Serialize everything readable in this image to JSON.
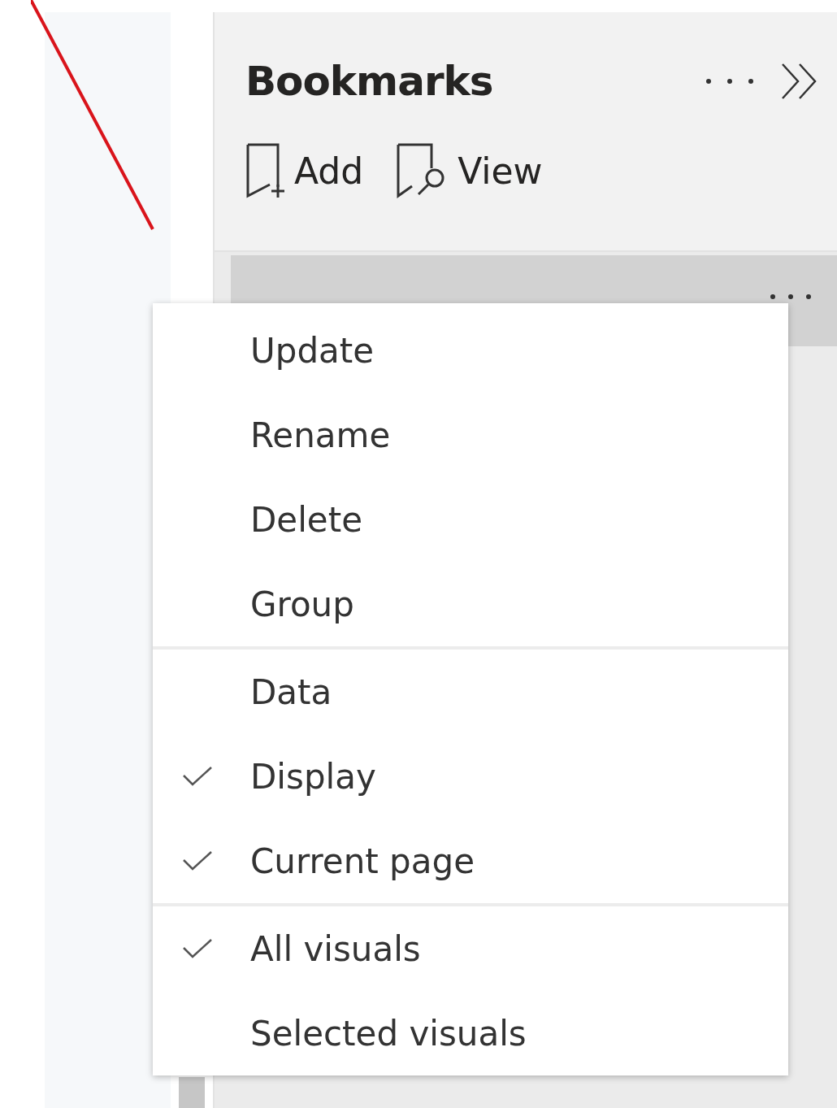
{
  "pane": {
    "title": "Bookmarks"
  },
  "toolbar": [
    {
      "kind": "add",
      "label": "Add"
    },
    {
      "kind": "view",
      "label": "View"
    }
  ],
  "bookmarks": [
    {
      "selected": true
    }
  ],
  "context_menu": {
    "sections": [
      [
        {
          "label": "Update"
        },
        {
          "label": "Rename"
        },
        {
          "label": "Delete"
        },
        {
          "label": "Group"
        }
      ],
      [
        {
          "label": "Data",
          "checked": false
        },
        {
          "label": "Display",
          "checked": true
        },
        {
          "label": "Current page",
          "checked": true
        }
      ],
      [
        {
          "label": "All visuals",
          "checked": true
        },
        {
          "label": "Selected visuals",
          "checked": false
        }
      ]
    ]
  }
}
